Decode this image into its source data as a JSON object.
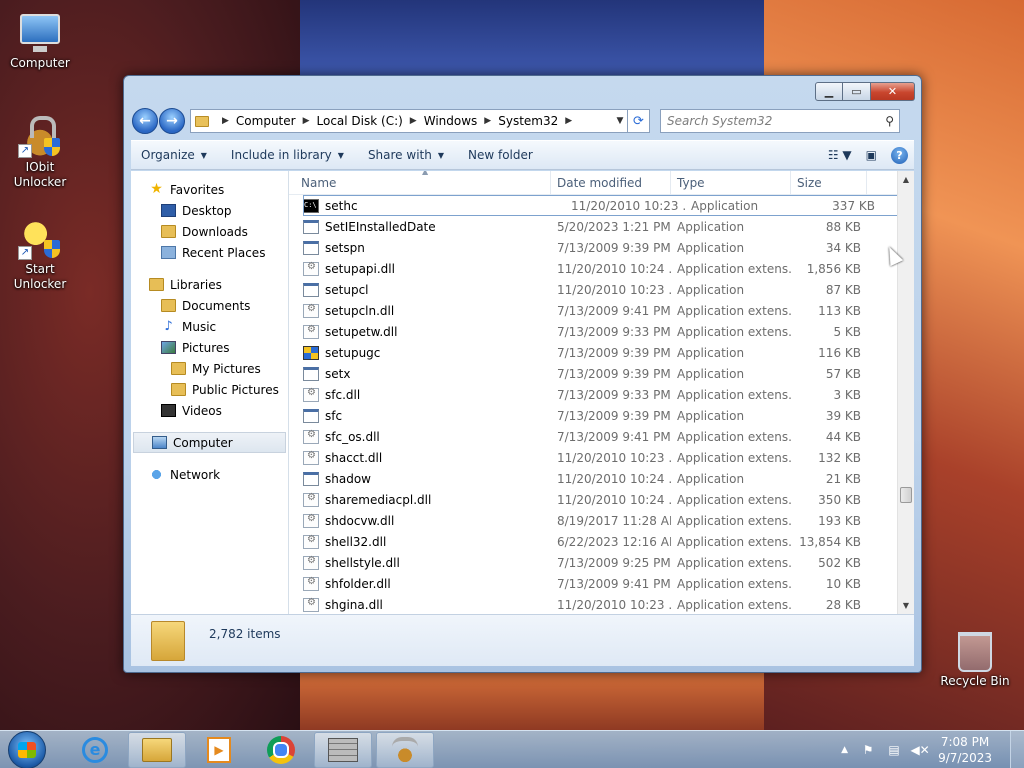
{
  "desktop": {
    "icons": [
      {
        "label": "Computer"
      },
      {
        "label": "IObit Unlocker"
      },
      {
        "label": "Start Unlocker"
      },
      {
        "label": "Recycle Bin"
      }
    ]
  },
  "window": {
    "breadcrumb": [
      "Computer",
      "Local Disk (C:)",
      "Windows",
      "System32"
    ],
    "search_placeholder": "Search System32",
    "toolbar": {
      "organize": "Organize",
      "include": "Include in library",
      "share": "Share with",
      "new_folder": "New folder"
    },
    "nav": {
      "favorites": "Favorites",
      "desktop": "Desktop",
      "downloads": "Downloads",
      "recent": "Recent Places",
      "libraries": "Libraries",
      "documents": "Documents",
      "music": "Music",
      "pictures": "Pictures",
      "my_pictures": "My Pictures",
      "public_pictures": "Public Pictures",
      "videos": "Videos",
      "computer": "Computer",
      "network": "Network"
    },
    "columns": {
      "name": "Name",
      "date": "Date modified",
      "type": "Type",
      "size": "Size"
    },
    "files": [
      {
        "name": "sethc",
        "date": "11/20/2010 10:23 ...",
        "type": "Application",
        "size": "337 KB",
        "icon": "cmd"
      },
      {
        "name": "SetIEInstalledDate",
        "date": "5/20/2023 1:21 PM",
        "type": "Application",
        "size": "88 KB",
        "icon": "app"
      },
      {
        "name": "setspn",
        "date": "7/13/2009 9:39 PM",
        "type": "Application",
        "size": "34 KB",
        "icon": "app"
      },
      {
        "name": "setupapi.dll",
        "date": "11/20/2010 10:24 ...",
        "type": "Application extens...",
        "size": "1,856 KB",
        "icon": "dll"
      },
      {
        "name": "setupcl",
        "date": "11/20/2010 10:23 ...",
        "type": "Application",
        "size": "87 KB",
        "icon": "app"
      },
      {
        "name": "setupcln.dll",
        "date": "7/13/2009 9:41 PM",
        "type": "Application extens...",
        "size": "113 KB",
        "icon": "dll"
      },
      {
        "name": "setupetw.dll",
        "date": "7/13/2009 9:33 PM",
        "type": "Application extens...",
        "size": "5 KB",
        "icon": "dll"
      },
      {
        "name": "setupugc",
        "date": "7/13/2009 9:39 PM",
        "type": "Application",
        "size": "116 KB",
        "icon": "ugc"
      },
      {
        "name": "setx",
        "date": "7/13/2009 9:39 PM",
        "type": "Application",
        "size": "57 KB",
        "icon": "app"
      },
      {
        "name": "sfc.dll",
        "date": "7/13/2009 9:33 PM",
        "type": "Application extens...",
        "size": "3 KB",
        "icon": "dll"
      },
      {
        "name": "sfc",
        "date": "7/13/2009 9:39 PM",
        "type": "Application",
        "size": "39 KB",
        "icon": "app"
      },
      {
        "name": "sfc_os.dll",
        "date": "7/13/2009 9:41 PM",
        "type": "Application extens...",
        "size": "44 KB",
        "icon": "dll"
      },
      {
        "name": "shacct.dll",
        "date": "11/20/2010 10:23 ...",
        "type": "Application extens...",
        "size": "132 KB",
        "icon": "dll"
      },
      {
        "name": "shadow",
        "date": "11/20/2010 10:24 ...",
        "type": "Application",
        "size": "21 KB",
        "icon": "app"
      },
      {
        "name": "sharemediacpl.dll",
        "date": "11/20/2010 10:24 ...",
        "type": "Application extens...",
        "size": "350 KB",
        "icon": "dll"
      },
      {
        "name": "shdocvw.dll",
        "date": "8/19/2017 11:28 AM",
        "type": "Application extens...",
        "size": "193 KB",
        "icon": "dll"
      },
      {
        "name": "shell32.dll",
        "date": "6/22/2023 12:16 AM",
        "type": "Application extens...",
        "size": "13,854 KB",
        "icon": "dll"
      },
      {
        "name": "shellstyle.dll",
        "date": "7/13/2009 9:25 PM",
        "type": "Application extens...",
        "size": "502 KB",
        "icon": "dll"
      },
      {
        "name": "shfolder.dll",
        "date": "7/13/2009 9:41 PM",
        "type": "Application extens...",
        "size": "10 KB",
        "icon": "dll"
      },
      {
        "name": "shgina.dll",
        "date": "11/20/2010 10:23 ...",
        "type": "Application extens...",
        "size": "28 KB",
        "icon": "dll"
      }
    ],
    "item_count": "2,782 items"
  },
  "taskbar": {
    "time": "7:08 PM",
    "date": "9/7/2023"
  }
}
